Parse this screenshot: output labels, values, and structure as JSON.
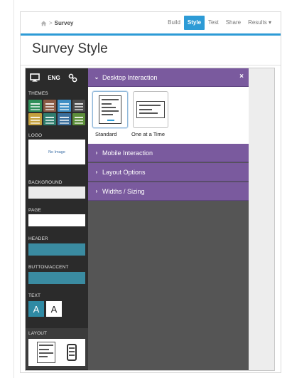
{
  "breadcrumb": {
    "separator": ">",
    "current": "Survey"
  },
  "nav": {
    "tabs": [
      {
        "label": "Build",
        "active": false
      },
      {
        "label": "Style",
        "active": true
      },
      {
        "label": "Test",
        "active": false
      },
      {
        "label": "Share",
        "active": false
      },
      {
        "label": "Results",
        "active": false,
        "dropdown": true
      }
    ]
  },
  "page": {
    "title": "Survey Style"
  },
  "sidebar": {
    "tools": {
      "lang": "ENG",
      "device_icon": "desktop-icon",
      "link_icon": "link-icon"
    },
    "themes_label": "THEMES",
    "theme_colors": [
      "#2f8f5a",
      "#8a5a44",
      "#3e8ec4",
      "#4a4a4a",
      "#c4a03e",
      "#2f7d6e",
      "#3a6e9c",
      "#5d8f3a"
    ],
    "logo_label": "LOGO",
    "logo_placeholder": "No Image",
    "background_label": "BACKGROUND",
    "background_color": "#ebebeb",
    "page_label": "PAGE",
    "page_color": "#ffffff",
    "header_label": "HEADER",
    "header_color": "#3a8ba1",
    "button_label": "BUTTON/ACCENT",
    "button_color": "#3a8ba1",
    "text_label": "TEXT",
    "text_sample": "A",
    "layout_label": "LAYOUT"
  },
  "panel": {
    "desktop_interaction": {
      "label": "Desktop Interaction",
      "expanded": true,
      "close": "×"
    },
    "options": [
      {
        "label": "Standard",
        "selected": true
      },
      {
        "label": "One at a Time",
        "selected": false
      }
    ],
    "sections": [
      {
        "label": "Mobile Interaction"
      },
      {
        "label": "Layout Options"
      },
      {
        "label": "Widths / Sizing"
      }
    ],
    "accent_color": "#7a5a9e"
  }
}
